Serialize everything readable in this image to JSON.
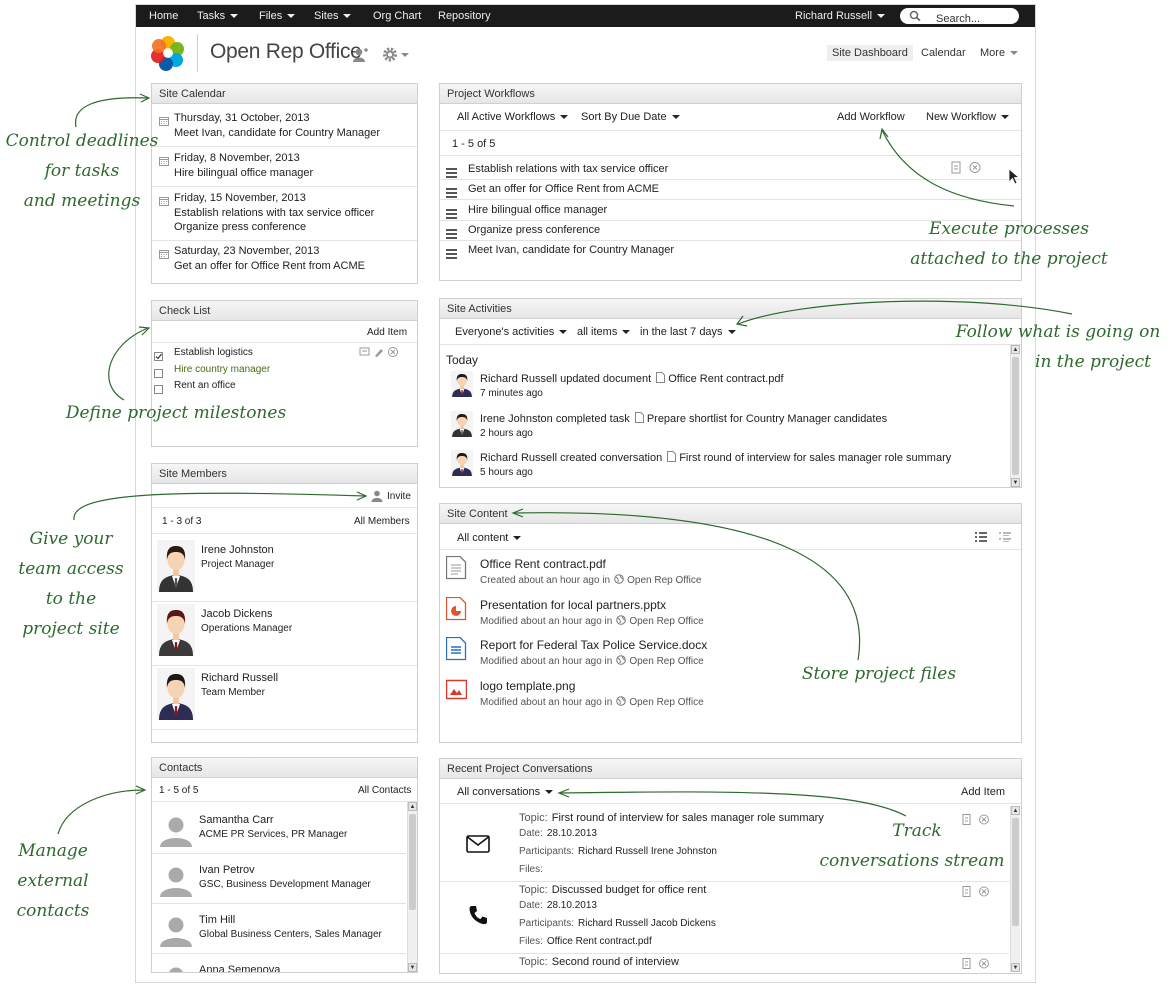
{
  "topbar": {
    "menu": [
      "Home",
      "Tasks",
      "Files",
      "Sites",
      "Org Chart",
      "Repository"
    ],
    "user": "Richard Russell",
    "search_placeholder": "Search..."
  },
  "header": {
    "site_title": "Open Rep Office",
    "nav": {
      "dashboard": "Site Dashboard",
      "calendar": "Calendar",
      "more": "More"
    }
  },
  "calendar": {
    "title": "Site Calendar",
    "events": [
      {
        "date": "Thursday, 31 October, 2013",
        "items": [
          "Meet Ivan, candidate for Country Manager"
        ]
      },
      {
        "date": "Friday, 8 November, 2013",
        "items": [
          "Hire bilingual office manager"
        ]
      },
      {
        "date": "Friday, 15 November, 2013",
        "items": [
          "Establish relations with tax service officer",
          "Organize press conference"
        ]
      },
      {
        "date": "Saturday, 23 November, 2013",
        "items": [
          "Get an offer for Office Rent from ACME"
        ]
      }
    ]
  },
  "checklist": {
    "title": "Check List",
    "add": "Add Item",
    "items": [
      "Establish logistics",
      "Hire country manager",
      "Rent an office"
    ]
  },
  "members": {
    "title": "Site Members",
    "invite": "Invite",
    "count": "1 - 3 of 3",
    "all": "All Members",
    "list": [
      {
        "name": "Irene Johnston",
        "role": "Project Manager"
      },
      {
        "name": "Jacob Dickens",
        "role": "Operations Manager"
      },
      {
        "name": "Richard Russell",
        "role": "Team Member"
      }
    ]
  },
  "contacts": {
    "title": "Contacts",
    "count": "1 - 5 of 5",
    "all": "All Contacts",
    "list": [
      {
        "name": "Samantha Carr",
        "org": "ACME PR Services, PR Manager"
      },
      {
        "name": "Ivan Petrov",
        "org": "GSC, Business Development Manager"
      },
      {
        "name": "Tim Hill",
        "org": "Global Business Centers, Sales Manager"
      },
      {
        "name": "Anna Semenova",
        "org": ""
      }
    ]
  },
  "workflows": {
    "title": "Project Workflows",
    "filter": "All Active Workflows",
    "sort": "Sort By Due Date",
    "add": "Add Workflow",
    "new": "New Workflow",
    "count": "1 - 5 of 5",
    "items": [
      "Establish relations with tax service officer",
      "Get an offer for Office Rent from ACME",
      "Hire bilingual office manager",
      "Organize press conference",
      "Meet Ivan, candidate for Country Manager"
    ]
  },
  "activities": {
    "title": "Site Activities",
    "filters": [
      "Everyone's activities",
      "all items",
      "in the last 7 days"
    ],
    "today": "Today",
    "list": [
      {
        "text": "Richard Russell updated document",
        "target": "Office Rent contract.pdf",
        "time": "7 minutes ago"
      },
      {
        "text": "Irene Johnston completed task",
        "target": "Prepare shortlist for Country Manager candidates",
        "time": "2 hours ago"
      },
      {
        "text": "Richard Russell created conversation",
        "target": "First round of interview for sales manager role summary",
        "time": "5 hours ago"
      }
    ]
  },
  "content": {
    "title": "Site Content",
    "filter": "All content",
    "site": "Open Rep Office",
    "files": [
      {
        "name": "Office Rent contract.pdf",
        "meta": "Created about an hour ago in",
        "color": "#777777"
      },
      {
        "name": "Presentation for local partners.pptx",
        "meta": "Modified about an hour ago in",
        "color": "#e2542d"
      },
      {
        "name": "Report for Federal Tax Police Service.docx",
        "meta": "Modified about an hour ago in",
        "color": "#2b6cc4"
      },
      {
        "name": "logo template.png",
        "meta": "Modified about an hour ago in",
        "color": "#d8392b"
      }
    ]
  },
  "conversations": {
    "title": "Recent Project Conversations",
    "filter": "All conversations",
    "add": "Add Item",
    "labels": {
      "topic": "Topic:",
      "date": "Date:",
      "participants": "Participants:",
      "files": "Files:"
    },
    "list": [
      {
        "topic": "First round of interview for sales manager role summary",
        "date": "28.10.2013",
        "participants": "Richard Russell Irene Johnston",
        "files": ""
      },
      {
        "topic": "Discussed budget for office rent",
        "date": "28.10.2013",
        "participants": "Richard Russell Jacob Dickens",
        "files": "Office Rent contract.pdf"
      },
      {
        "topic": "Second round of interview",
        "date": "",
        "participants": "",
        "files": ""
      }
    ]
  },
  "annotations": {
    "calendar": [
      "Control deadlines",
      "for tasks",
      "and meetings"
    ],
    "milestones": [
      "Define project milestones"
    ],
    "team": [
      "Give your",
      "team access",
      "to the",
      "project site"
    ],
    "contacts": [
      "Manage",
      "external",
      "contacts"
    ],
    "workflows": [
      "Execute processes",
      "attached to the project"
    ],
    "activities": [
      "Follow what is going on",
      "in the project"
    ],
    "files": [
      "Store project files"
    ],
    "conversations": [
      "Track",
      "conversations stream"
    ]
  }
}
